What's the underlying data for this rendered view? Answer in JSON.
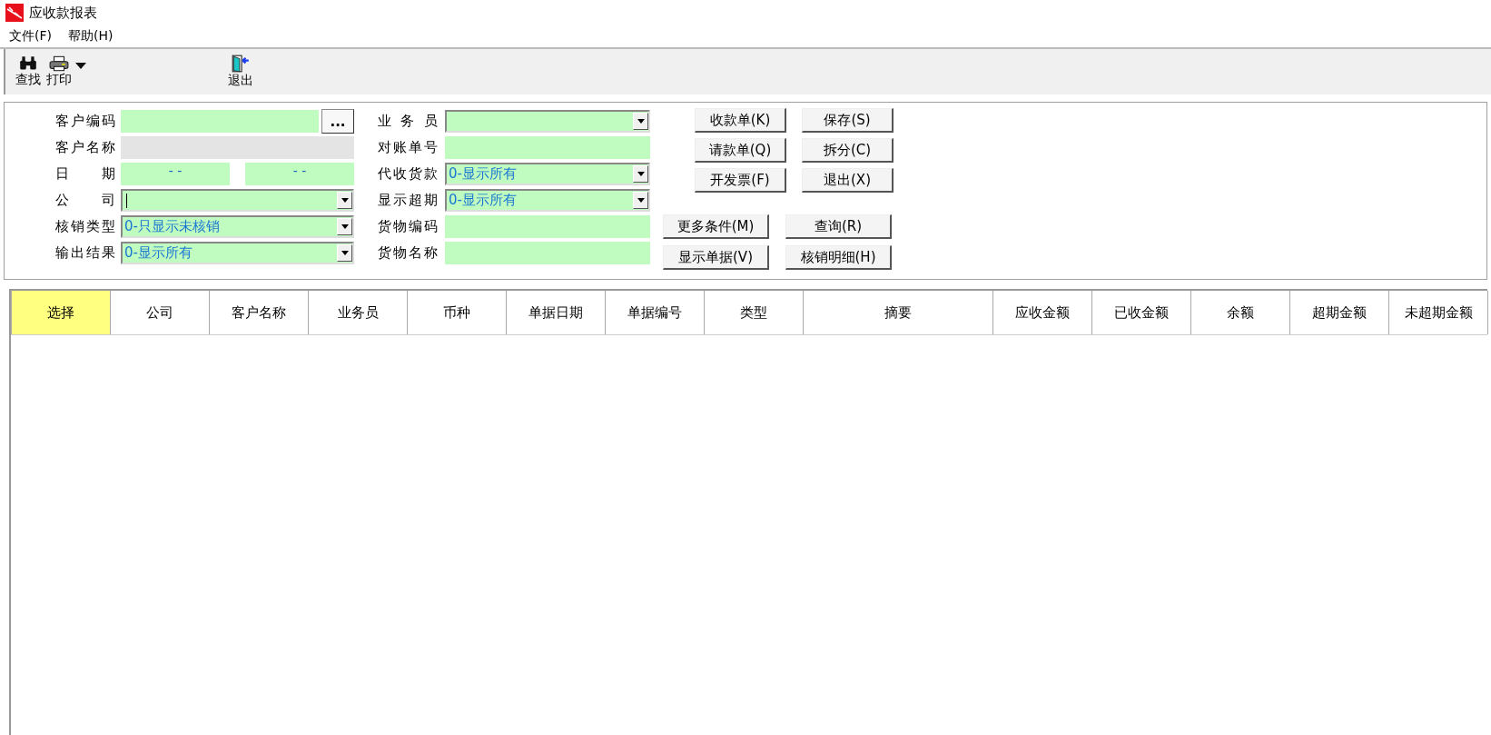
{
  "window": {
    "title": "应收款报表"
  },
  "menu": [
    {
      "label": "文件(F)"
    },
    {
      "label": "帮助(H)"
    }
  ],
  "toolbar": [
    {
      "kind": "find",
      "label": "查找",
      "dropdown": false
    },
    {
      "kind": "print",
      "label": "打印",
      "dropdown": true
    },
    {
      "kind": "exit",
      "label": "退出",
      "dropdown": false
    }
  ],
  "form": {
    "left": [
      {
        "label": "客户编码",
        "kind": "picker",
        "button": "..."
      },
      {
        "label": "客户名称",
        "kind": "readonly"
      },
      {
        "label": "日 期",
        "kind": "date_range",
        "values": [
          "-  -",
          "-  -"
        ]
      },
      {
        "label": "公 司",
        "kind": "combo",
        "focused": true
      },
      {
        "label": "核销类型",
        "kind": "combo",
        "value": "0-只显示未核销",
        "focused": false
      },
      {
        "label": "输出结果",
        "kind": "combo",
        "value": "0-显示所有",
        "focused": false
      }
    ],
    "middle": [
      {
        "label": "业 务 员",
        "kind": "combo",
        "focused": false
      },
      {
        "label": "对账单号",
        "kind": "text"
      },
      {
        "label": "代收货款",
        "kind": "combo",
        "value": "0-显示所有",
        "focused": false
      },
      {
        "label": "显示超期",
        "kind": "combo",
        "value": "0-显示所有",
        "focused": false
      },
      {
        "label": "货物编码",
        "kind": "text"
      },
      {
        "label": "货物名称",
        "kind": "text"
      }
    ],
    "buttons_top": [
      "收款单(K)",
      "保存(S)",
      "请款单(Q)",
      "拆分(C)",
      "开发票(F)",
      "退出(X)"
    ],
    "buttons_bottom": [
      "更多条件(M)",
      "查询(R)",
      "显示单据(V)",
      "核销明细(H)"
    ]
  },
  "table": {
    "columns": [
      {
        "label": "选择",
        "selected": true
      },
      {
        "label": "公司",
        "selected": false
      },
      {
        "label": "客户名称",
        "selected": false
      },
      {
        "label": "业务员",
        "selected": false
      },
      {
        "label": "币种",
        "selected": false
      },
      {
        "label": "单据日期",
        "selected": false
      },
      {
        "label": "单据编号",
        "selected": false
      },
      {
        "label": "类型",
        "selected": false
      },
      {
        "label": "摘要",
        "selected": false,
        "wide": true
      },
      {
        "label": "应收金额",
        "selected": false
      },
      {
        "label": "已收金额",
        "selected": false
      },
      {
        "label": "余额",
        "selected": false
      },
      {
        "label": "超期金额",
        "selected": false
      },
      {
        "label": "未超期金额",
        "selected": false
      }
    ]
  }
}
